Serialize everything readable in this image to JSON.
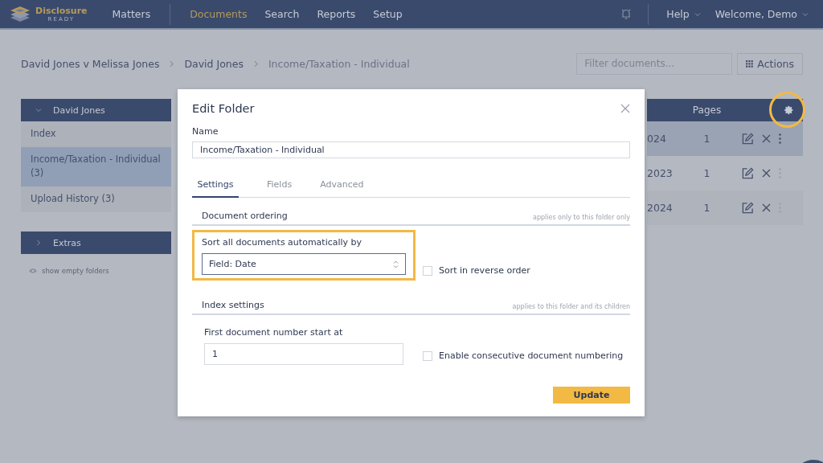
{
  "nav": {
    "brand": "Disclosure",
    "brand_sub": "READY",
    "items": [
      {
        "label": "Matters",
        "selected": false
      },
      {
        "label": "Documents",
        "selected": true
      },
      {
        "label": "Search",
        "selected": false
      },
      {
        "label": "Reports",
        "selected": false
      },
      {
        "label": "Setup",
        "selected": false
      }
    ],
    "help": "Help",
    "user": "Welcome, Demo"
  },
  "breadcrumbs": [
    "David Jones v Melissa Jones",
    "David Jones",
    "Income/Taxation - Individual"
  ],
  "filter": {
    "placeholder": "Filter documents..."
  },
  "actions_button": "Actions",
  "sidebar": {
    "groups": [
      {
        "title": "David Jones",
        "expanded": true,
        "items": [
          {
            "label": "Index",
            "selected": false
          },
          {
            "label": "Income/Taxation - Individual (3)",
            "selected": true
          },
          {
            "label": "Upload History (3)",
            "selected": false
          }
        ]
      },
      {
        "title": "Extras",
        "expanded": false
      }
    ],
    "show_empty": "show empty folders"
  },
  "table": {
    "columns": [
      "Pages"
    ],
    "rows": [
      {
        "column_1": "024",
        "pages": "1",
        "selected": true
      },
      {
        "column_1": "2023",
        "pages": "1",
        "selected": false
      },
      {
        "column_1": "2024",
        "pages": "1",
        "selected": false
      }
    ]
  },
  "modal": {
    "title": "Edit Folder",
    "name_label": "Name",
    "name_value": "Income/Taxation - Individual",
    "tabs": [
      {
        "label": "Settings",
        "selected": true
      },
      {
        "label": "Fields",
        "selected": false
      },
      {
        "label": "Advanced",
        "selected": false
      }
    ],
    "ordering": {
      "heading": "Document ordering",
      "note": "applies only to this folder only",
      "sort_label": "Sort all documents automatically by",
      "sort_value": "Field: Date",
      "reverse_label": "Sort in reverse order",
      "reverse_checked": false
    },
    "index": {
      "heading": "Index settings",
      "note": "applies to this folder and its children",
      "start_label": "First document number start at",
      "start_value": "1",
      "consecutive_label": "Enable consecutive document numbering",
      "consecutive_checked": false
    },
    "update_button": "Update"
  }
}
